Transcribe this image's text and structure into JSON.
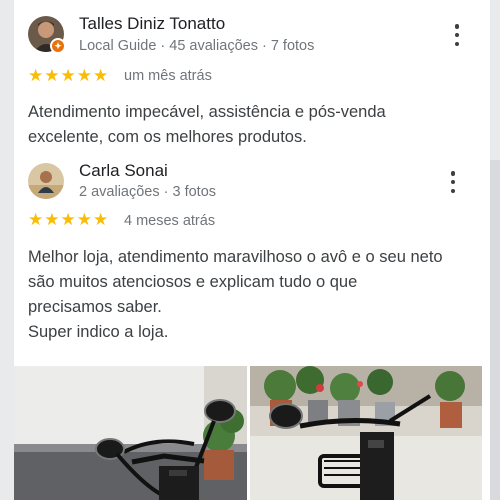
{
  "reviews": [
    {
      "name": "Talles Diniz Tonatto",
      "meta": "Local Guide · 45 avaliações · 7 fotos",
      "badge": "✦",
      "rating": 5,
      "when": "um mês atrás",
      "text": [
        "Atendimento impecável, assistência e pós-venda",
        "excelente, com os melhores produtos."
      ]
    },
    {
      "name": "Carla Sonai",
      "meta": "2 avaliações · 3 fotos",
      "rating": 5,
      "when": "4 meses atrás",
      "text": [
        "Melhor loja, atendimento maravilhoso o avô e o seu neto",
        "são muitos atenciosos e explicam tudo o que",
        "precisamos saber.",
        "Super indico a loja."
      ]
    }
  ],
  "colors": {
    "star": "#fbbc04",
    "badge": "#e8710a"
  },
  "icons": {
    "menu": "more-vert-icon",
    "star": "star-icon"
  }
}
